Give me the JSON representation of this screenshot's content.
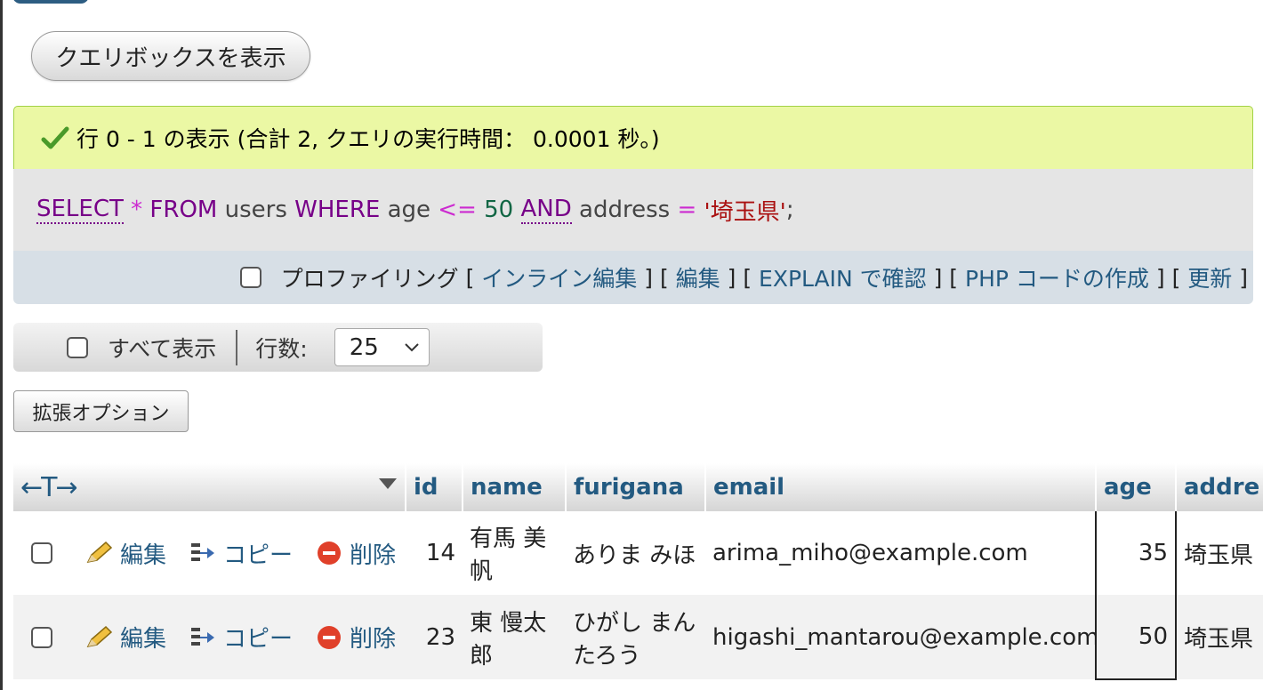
{
  "query_box_button": "クエリボックスを表示",
  "success_message": "行 0 - 1 の表示 (合計 2, クエリの実行時間： 0.0001 秒。)",
  "sql": {
    "select": "SELECT",
    "star": "*",
    "from": "FROM",
    "table": "users",
    "where": "WHERE",
    "col1": "age",
    "op1": "<=",
    "val1": "50",
    "and": "AND",
    "col2": "address",
    "op2": "=",
    "val2": "'埼玉県'",
    "end": ";"
  },
  "actions": {
    "profiling": "プロファイリング",
    "inline_edit": "インライン編集",
    "edit": "編集",
    "explain": "EXPLAIN で確認",
    "php": "PHP コードの作成",
    "refresh": "更新"
  },
  "nav": {
    "show_all": "すべて表示",
    "rows_label": "行数:",
    "rows_value": "25"
  },
  "extended_options": "拡張オプション",
  "table": {
    "arrows": "←T→",
    "columns": [
      "id",
      "name",
      "furigana",
      "email",
      "age",
      "addre"
    ],
    "row_actions": {
      "edit": "編集",
      "copy": "コピー",
      "delete": "削除"
    },
    "rows": [
      {
        "id": "14",
        "name": "有馬 美帆",
        "furigana": "ありま みほ",
        "email": "arima_miho@example.com",
        "age": "35",
        "address": "埼玉県"
      },
      {
        "id": "23",
        "name": "東 慢太郎",
        "furigana": "ひがし まんたろう",
        "email": "higashi_mantarou@example.com",
        "age": "50",
        "address": "埼玉県"
      }
    ]
  },
  "colors": {
    "link": "#235a81",
    "success_bg": "#ebf8a4",
    "sql_keyword": "#770088",
    "sql_operator": "#cc2ad0",
    "sql_number": "#116644",
    "sql_string": "#aa1111"
  }
}
